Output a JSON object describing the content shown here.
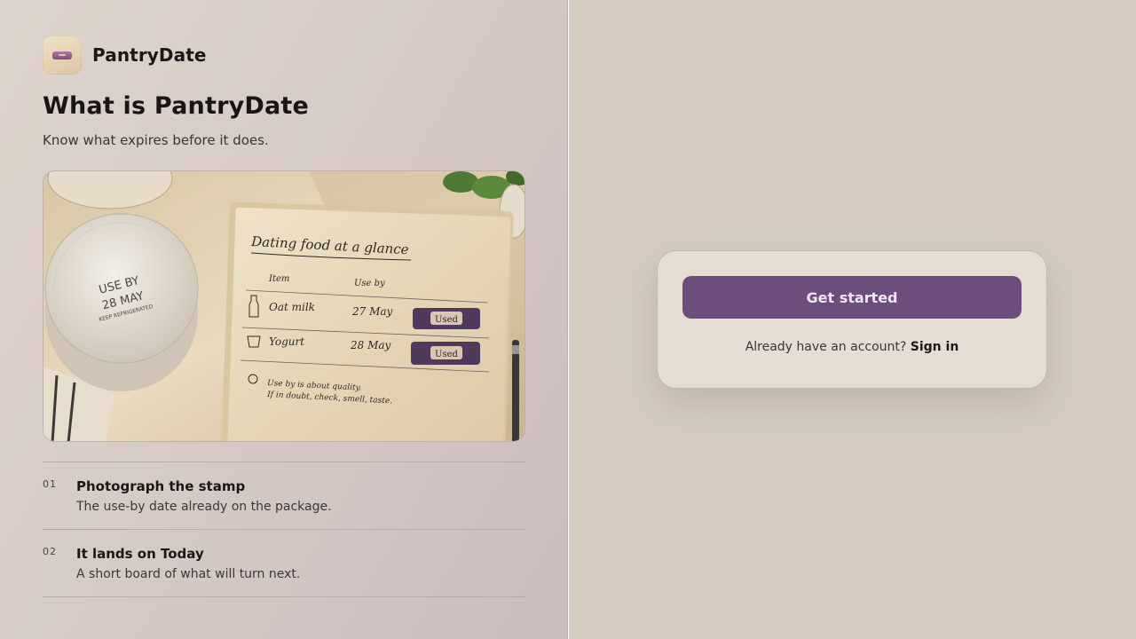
{
  "brand": {
    "name": "PantryDate",
    "icon": "tin-icon"
  },
  "hero": {
    "title": "What is PantryDate",
    "subtitle": "Know what expires before it does."
  },
  "illustration": {
    "lid_line1": "USE BY",
    "lid_line2": "28 MAY",
    "lid_line3": "KEEP REFRIGERATED",
    "notebook_title": "Dating food at a glance",
    "col_item": "Item",
    "col_use_by": "Use by",
    "rows": [
      {
        "item": "Oat milk",
        "date": "27 May",
        "tag": "Used"
      },
      {
        "item": "Yogurt",
        "date": "28 May",
        "tag": "Used"
      }
    ],
    "note_line1": "Use by is about quality.",
    "note_line2": "If in doubt, check, smell, taste."
  },
  "steps": [
    {
      "num": "01",
      "title": "Photograph the stamp",
      "desc": "The use-by date already on the package."
    },
    {
      "num": "02",
      "title": "It lands on Today",
      "desc": "A short board of what will turn next."
    }
  ],
  "auth": {
    "get_started": "Get started",
    "prompt": "Already have an account?",
    "sign_in": "Sign in"
  },
  "colors": {
    "accent": "#6b4e7c",
    "left_panel": "#d6cbc5",
    "right_panel": "#d5ccbf",
    "card": "#e5ddd3"
  }
}
